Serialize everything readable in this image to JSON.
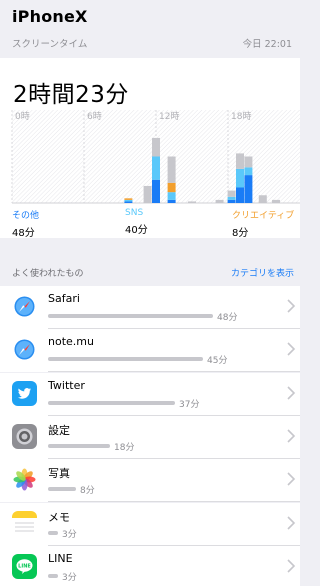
{
  "header": {
    "device_name": "iPhoneX",
    "section_label": "スクリーンタイム",
    "date_time": "今日 22:01"
  },
  "total_time": "2時間23分",
  "chart_data": {
    "type": "bar",
    "hour_labels": [
      "0時",
      "6時",
      "12時",
      "18時"
    ],
    "colors": {
      "other": "#1a7cf6",
      "sns": "#5ac8fa",
      "creative": "#f29f2d",
      "rest": "#c7c7cc"
    },
    "series": [
      {
        "name": "その他",
        "values": [
          0,
          0,
          0,
          0,
          0,
          0,
          0,
          0,
          0,
          0,
          0,
          0,
          0,
          0,
          0,
          0,
          0,
          0,
          0,
          0,
          0,
          0,
          0,
          0,
          0,
          0,
          0,
          0,
          0,
          0,
          0,
          0,
          0,
          0,
          0,
          0,
          0,
          0,
          0,
          0,
          2,
          0,
          1,
          0,
          0,
          0,
          0,
          0,
          0,
          0,
          0,
          0,
          0,
          0,
          0,
          0,
          0,
          0,
          0,
          0,
          0,
          0,
          0,
          0,
          0,
          0,
          0,
          4,
          0,
          3,
          0,
          0,
          0,
          0,
          0,
          0,
          0,
          0,
          0,
          0,
          0,
          0,
          0,
          0,
          0,
          0,
          0,
          0,
          0,
          0,
          0,
          0,
          0,
          0,
          0,
          0,
          0,
          0,
          0,
          0,
          0,
          0,
          0,
          0,
          0,
          0,
          0,
          0,
          0,
          0,
          0,
          0,
          0,
          0,
          0,
          0,
          0,
          0,
          0,
          0,
          0,
          0,
          0,
          0,
          0,
          0,
          0,
          0,
          0,
          0,
          0,
          0,
          0,
          0,
          0,
          0,
          0,
          0,
          0,
          0,
          0,
          0,
          0,
          0,
          0
        ]
      },
      {
        "name": "SNS",
        "values": []
      },
      {
        "name": "クリエイティブ",
        "values": []
      }
    ],
    "bars": [
      {
        "hour": 9.7,
        "other": 1,
        "sns": 1,
        "creative": 1,
        "rest": 0
      },
      {
        "hour": 11.3,
        "other": 0,
        "sns": 0,
        "creative": 0,
        "rest": 11
      },
      {
        "hour": 12.0,
        "other": 15,
        "sns": 15,
        "creative": 0,
        "rest": 12
      },
      {
        "hour": 13.3,
        "other": 2,
        "sns": 5,
        "creative": 6,
        "rest": 17
      },
      {
        "hour": 15.0,
        "other": 0,
        "sns": 0,
        "creative": 0,
        "rest": 1
      },
      {
        "hour": 17.3,
        "other": 0,
        "sns": 0,
        "creative": 0,
        "rest": 2
      },
      {
        "hour": 18.3,
        "other": 2,
        "sns": 2,
        "creative": 0,
        "rest": 4
      },
      {
        "hour": 19.0,
        "other": 10,
        "sns": 12,
        "creative": 0,
        "rest": 10
      },
      {
        "hour": 19.7,
        "other": 18,
        "sns": 5,
        "creative": 0,
        "rest": 7
      },
      {
        "hour": 20.9,
        "other": 0,
        "sns": 0,
        "creative": 0,
        "rest": 5
      },
      {
        "hour": 22.0,
        "other": 0,
        "sns": 0,
        "creative": 0,
        "rest": 2
      }
    ],
    "ylim": [
      0,
      60
    ]
  },
  "categories": [
    {
      "name": "その他",
      "value": "48分",
      "color": "#1a7cf6"
    },
    {
      "name": "SNS",
      "value": "40分",
      "color": "#5ac8fa"
    },
    {
      "name": "クリエイティブ",
      "value": "8分",
      "color": "#f29f2d"
    }
  ],
  "apps_section": {
    "title": "よく使われたもの",
    "link": "カテゴリを表示"
  },
  "apps": [
    {
      "name": "Safari",
      "duration": "48分",
      "minutes": 48,
      "icon": "safari-icon"
    },
    {
      "name": "note.mu",
      "duration": "45分",
      "minutes": 45,
      "icon": "safari-icon"
    },
    {
      "name": "Twitter",
      "duration": "37分",
      "minutes": 37,
      "icon": "twitter-icon"
    },
    {
      "name": "設定",
      "duration": "18分",
      "minutes": 18,
      "icon": "settings-icon"
    },
    {
      "name": "写真",
      "duration": "8分",
      "minutes": 8,
      "icon": "photos-icon"
    },
    {
      "name": "メモ",
      "duration": "3分",
      "minutes": 3,
      "icon": "notes-icon"
    },
    {
      "name": "LINE",
      "duration": "3分",
      "minutes": 3,
      "icon": "line-icon"
    }
  ]
}
